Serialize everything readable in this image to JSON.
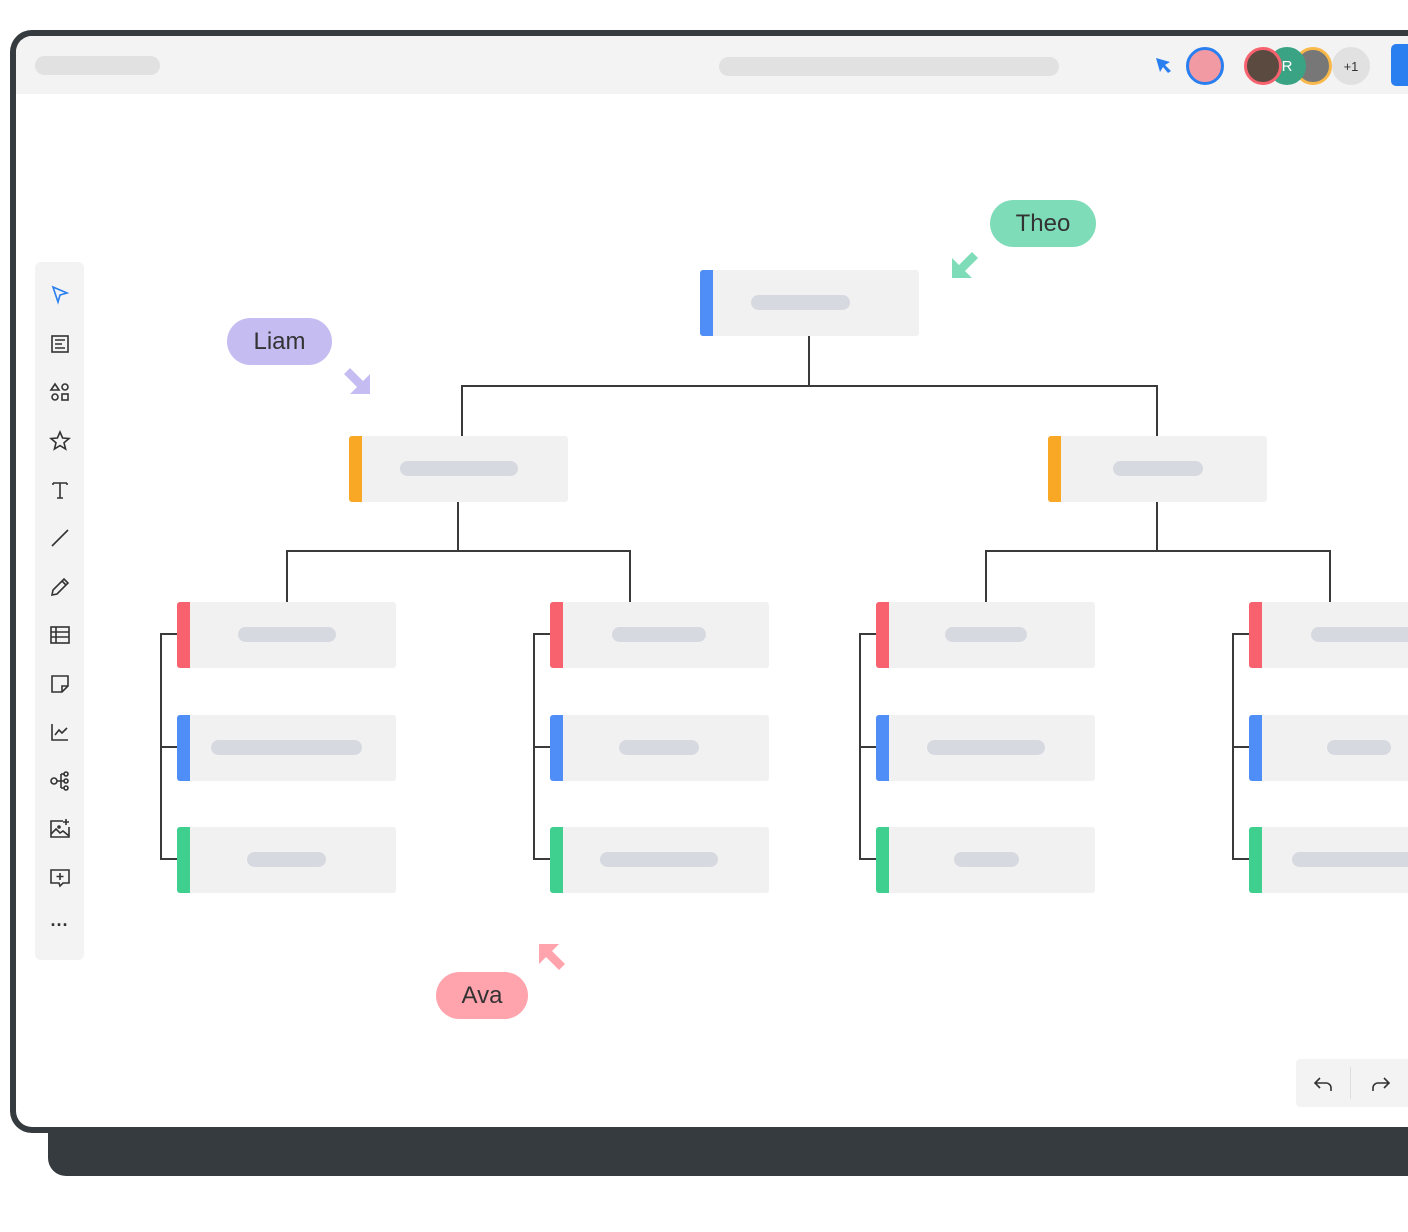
{
  "topbar": {
    "collaborators": [
      {
        "name": "user-1",
        "ring": "#2a7ff0"
      },
      {
        "name": "user-2",
        "ring": "#f7626e"
      },
      {
        "name": "user-3",
        "initial": "R",
        "bg": "#3aa383"
      },
      {
        "name": "user-4",
        "ring": "#f9b84a"
      }
    ],
    "overflow_count": "+1"
  },
  "toolbar": {
    "tools": [
      "select",
      "template",
      "shapes",
      "star",
      "text",
      "line",
      "pen",
      "table",
      "sticky-note",
      "chart",
      "mind-map",
      "image-upload",
      "comment",
      "more"
    ]
  },
  "colors": {
    "accent": "#2a7ff0",
    "root": "#4f8ef7",
    "level2": "#f9a825",
    "red": "#f7626e",
    "blue": "#4f8ef7",
    "green": "#3fcf8e"
  },
  "cursors": [
    {
      "name": "Theo",
      "color": "#7fdcb9"
    },
    {
      "name": "Liam",
      "color": "#c5bdf2"
    },
    {
      "name": "Ava",
      "color": "#ffa3ad"
    }
  ]
}
